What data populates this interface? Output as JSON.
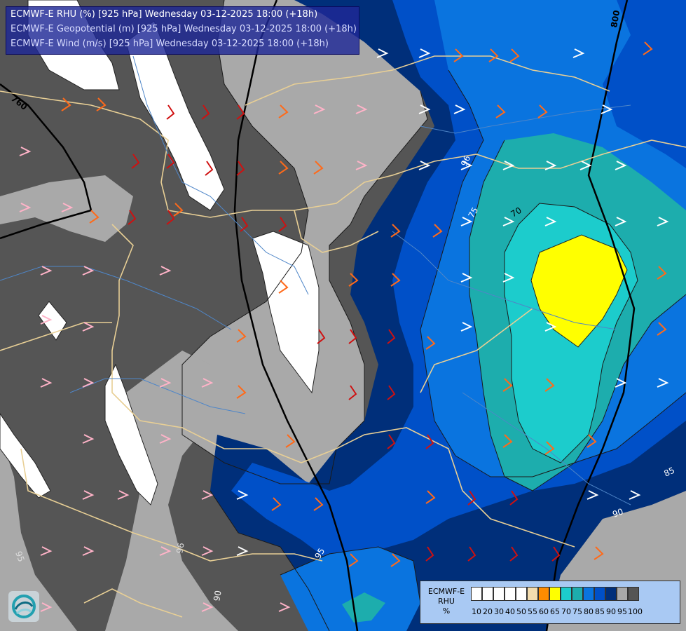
{
  "header": {
    "line1": "ECMWF-E RHU (%) [925 hPa] Wednesday 03-12-2025 18:00 (+18h)",
    "line2": "ECMWF-E Geopotential (m) [925 hPa] Wednesday 03-12-2025 18:00 (+18h)",
    "line3": "ECMWF-E Wind (m/s) [925 hPa] Wednesday 03-12-2025 18:00 (+18h)"
  },
  "map": {
    "contour_labels": [
      "760",
      "800",
      "96",
      "75",
      "70",
      "85",
      "90",
      "95",
      "96",
      "90",
      "95"
    ],
    "colors": {
      "gray_dark": "#555555",
      "gray_light": "#a9a9a9",
      "white": "#ffffff",
      "blue_dark": "#002f7a",
      "blue_mid": "#0050c8",
      "blue_light": "#0a74df",
      "teal": "#1dadad",
      "cyan": "#1ccccc",
      "yellow": "#ffff00",
      "border": "#e8cf95",
      "river": "#4f86c8"
    }
  },
  "legend": {
    "title": "ECMWF-E RHU %",
    "title_lines": [
      "ECMWF-E",
      "RHU",
      "%"
    ],
    "colors": [
      "#ffffff",
      "#ffffff",
      "#ffffff",
      "#ffffff",
      "#ffffff",
      "#f3dcae",
      "#ff8c00",
      "#ffff00",
      "#1ccccc",
      "#1dadad",
      "#0a74df",
      "#0050c8",
      "#002f7a",
      "#a9a9a9",
      "#555555"
    ],
    "ticks": [
      "10",
      "20",
      "30",
      "40",
      "50",
      "55",
      "60",
      "65",
      "70",
      "75",
      "80",
      "85",
      "90",
      "95",
      "100"
    ]
  },
  "logo": {
    "icon": "ecmwf-logo-icon"
  }
}
